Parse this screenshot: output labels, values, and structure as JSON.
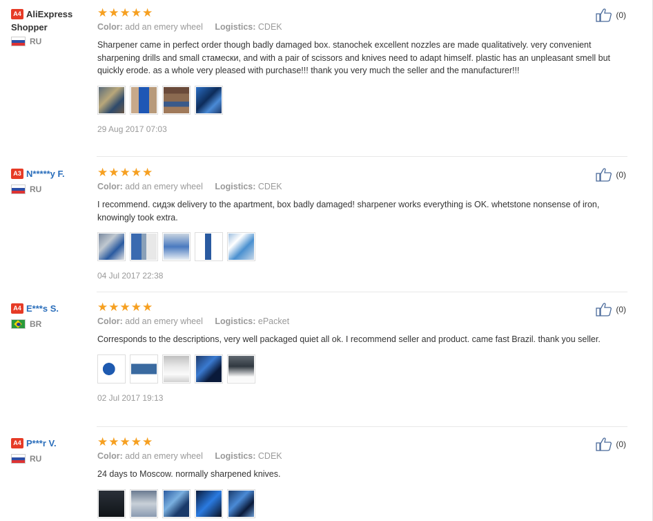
{
  "labels": {
    "color": "Color:",
    "logistics": "Logistics:"
  },
  "colors": {
    "star": "#f6a021",
    "level_badge": "#e63b26",
    "link_name": "#2a6ebb"
  },
  "reviews": [
    {
      "level": "A4",
      "name": "AliExpress Shopper",
      "country": "RU",
      "flag": "ru-flag",
      "stars": 5,
      "color_value": "add an emery wheel",
      "logistics_value": "CDEK",
      "text": "Sharpener came in perfect order though badly damaged box. stanochek excellent nozzles are made qualitatively. very convenient sharpening drills and small стамески, and with a pair of scissors and knives need to adapt himself. plastic has an unpleasant smell but quickly erode. as a whole very pleased with purchase!!! thank you very much the seller and the manufacturer!!!",
      "photos": 4,
      "date": "29 Aug 2017 07:03",
      "helpful": "(0)"
    },
    {
      "level": "A3",
      "name": "N*****y F.",
      "country": "RU",
      "flag": "ru-flag",
      "stars": 5,
      "color_value": "add an emery wheel",
      "logistics_value": "CDEK",
      "text": "I recommend. сидэк delivery to the apartment, box badly damaged! sharpener works everything is OK. whetstone nonsense of iron, knowingly took extra.",
      "photos": 5,
      "date": "04 Jul 2017 22:38",
      "helpful": "(0)"
    },
    {
      "level": "A4",
      "name": "E***s S.",
      "country": "BR",
      "flag": "br-flag",
      "stars": 5,
      "color_value": "add an emery wheel",
      "logistics_value": "ePacket",
      "text": "Corresponds to the descriptions, very well packaged quiet all ok. I recommend seller and product. came fast Brazil. thank you seller.",
      "photos": 5,
      "date": "02 Jul 2017 19:13",
      "helpful": "(0)"
    },
    {
      "level": "A4",
      "name": "P***r V.",
      "country": "RU",
      "flag": "ru-flag",
      "stars": 5,
      "color_value": "add an emery wheel",
      "logistics_value": "CDEK",
      "text": "24 days to Moscow. normally sharpened knives.",
      "photos": 5,
      "date": "",
      "helpful": "(0)"
    }
  ]
}
